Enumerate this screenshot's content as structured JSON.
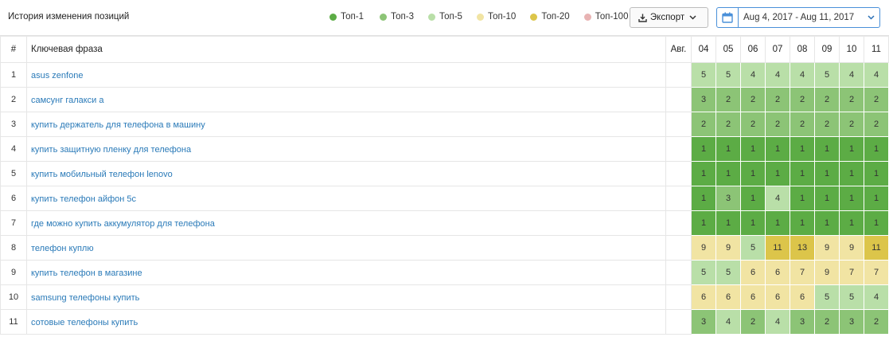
{
  "header": {
    "title": "История изменения позиций",
    "legend": [
      {
        "label": "Топ-1",
        "color": "#5cac45"
      },
      {
        "label": "Топ-3",
        "color": "#8cc476"
      },
      {
        "label": "Топ-5",
        "color": "#b9dfa8"
      },
      {
        "label": "Топ-10",
        "color": "#f1e4a3"
      },
      {
        "label": "Топ-20",
        "color": "#dcc54a"
      },
      {
        "label": "Топ-100",
        "color": "#e8b3b3"
      }
    ],
    "export_label": "Экспорт",
    "date_range": "Aug 4, 2017 - Aug 11, 2017"
  },
  "table": {
    "col_num": "#",
    "col_keyword": "Ключевая фраза",
    "col_avg": "Авг.",
    "days": [
      "04",
      "05",
      "06",
      "07",
      "08",
      "09",
      "10",
      "11"
    ],
    "rows": [
      {
        "num": "1",
        "keyword": "asus zenfone",
        "avg": "",
        "values": [
          5,
          5,
          4,
          4,
          4,
          5,
          4,
          4
        ]
      },
      {
        "num": "2",
        "keyword": "самсунг галакси а",
        "avg": "",
        "values": [
          3,
          2,
          2,
          2,
          2,
          2,
          2,
          2
        ]
      },
      {
        "num": "3",
        "keyword": "купить держатель для телефона в машину",
        "avg": "",
        "values": [
          2,
          2,
          2,
          2,
          2,
          2,
          2,
          2
        ]
      },
      {
        "num": "4",
        "keyword": "купить защитную пленку для телефона",
        "avg": "",
        "values": [
          1,
          1,
          1,
          1,
          1,
          1,
          1,
          1
        ]
      },
      {
        "num": "5",
        "keyword": "купить мобильный телефон lenovo",
        "avg": "",
        "values": [
          1,
          1,
          1,
          1,
          1,
          1,
          1,
          1
        ]
      },
      {
        "num": "6",
        "keyword": "купить телефон айфон 5с",
        "avg": "",
        "values": [
          1,
          3,
          1,
          4,
          1,
          1,
          1,
          1
        ]
      },
      {
        "num": "7",
        "keyword": "где можно купить аккумулятор для телефона",
        "avg": "",
        "values": [
          1,
          1,
          1,
          1,
          1,
          1,
          1,
          1
        ]
      },
      {
        "num": "8",
        "keyword": "телефон куплю",
        "avg": "",
        "values": [
          9,
          9,
          5,
          11,
          13,
          9,
          9,
          11
        ]
      },
      {
        "num": "9",
        "keyword": "купить телефон в магазине",
        "avg": "",
        "values": [
          5,
          5,
          6,
          6,
          7,
          9,
          7,
          7
        ]
      },
      {
        "num": "10",
        "keyword": "samsung телефоны купить",
        "avg": "",
        "values": [
          6,
          6,
          6,
          6,
          6,
          5,
          5,
          4
        ]
      },
      {
        "num": "11",
        "keyword": "сотовые телефоны купить",
        "avg": "",
        "values": [
          3,
          4,
          2,
          4,
          3,
          2,
          3,
          2
        ]
      }
    ]
  }
}
